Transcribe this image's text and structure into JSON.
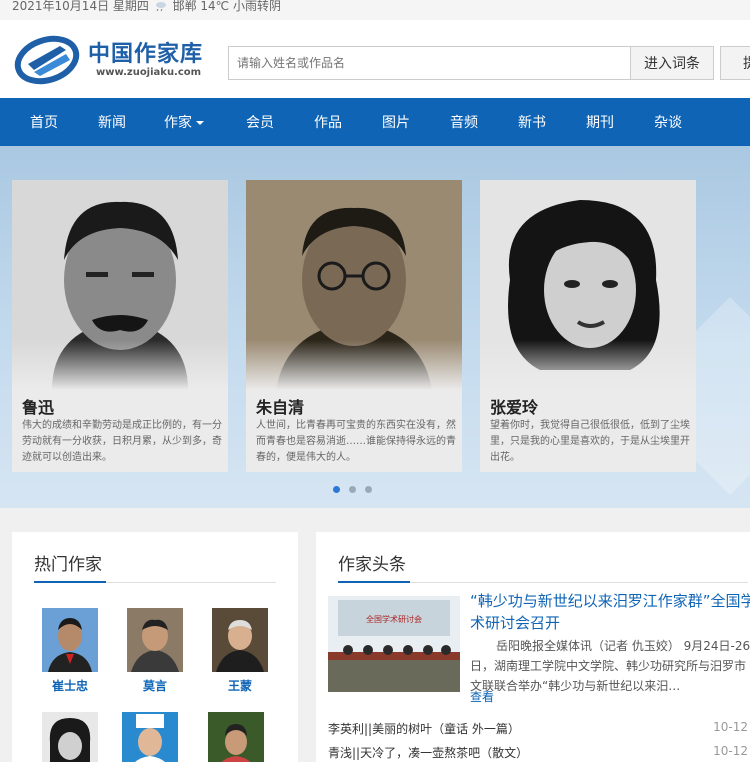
{
  "topbar": {
    "text_date": "2021年10月14日 星期四",
    "text_weather": "邯郸 14℃ 小雨转阴"
  },
  "logo": {
    "title": "中国作家库",
    "url": "www.zuojiaku.com"
  },
  "search": {
    "placeholder": "请输入姓名或作品名",
    "button1": "进入词条",
    "button2": "提"
  },
  "nav": [
    "首页",
    "新闻",
    "作家",
    "会员",
    "作品",
    "图片",
    "音频",
    "新书",
    "期刊",
    "杂谈"
  ],
  "carousel": [
    {
      "name": "鲁迅",
      "desc": "伟大的成绩和辛勤劳动是成正比例的，有一分劳动就有一分收获，日积月累，从少到多，奇迹就可以创造出来。"
    },
    {
      "name": "朱自清",
      "desc": "人世间，比青春再可宝贵的东西实在没有，然而青春也是容易消逝……谁能保持得永远的青春的，便是伟大的人。"
    },
    {
      "name": "张爱玲",
      "desc": "望着你时，我觉得自己很低很低，低到了尘埃里，只是我的心里是喜欢的，于是从尘埃里开出花。"
    }
  ],
  "hot_authors": {
    "title": "热门作家",
    "items": [
      {
        "name": "崔士忠"
      },
      {
        "name": "莫言"
      },
      {
        "name": "王蒙"
      },
      {
        "name": ""
      },
      {
        "name": ""
      },
      {
        "name": ""
      }
    ]
  },
  "headlines": {
    "title": "作家头条",
    "featured_title": "“韩少功与新世纪以来汨罗江作家群”全国学术研讨会召开",
    "featured_body": "岳阳晚报全媒体讯（记者 仇玉姣） 9月24日-26日，湖南理工学院中文学院、韩少功研究所与汨罗市文联联合举办“韩少功与新世纪以来汨…",
    "more": "查看",
    "thumb_caption": "全国学术研讨会",
    "list": [
      {
        "title": "李英利||美丽的树叶（童话 外一篇）",
        "date": "10-12"
      },
      {
        "title": "青浅||天冷了，凑一壶熬茶吧（散文）",
        "date": "10-12"
      }
    ]
  },
  "colors": {
    "brand": "#0f64b6",
    "accent": "#2a7ad3"
  }
}
